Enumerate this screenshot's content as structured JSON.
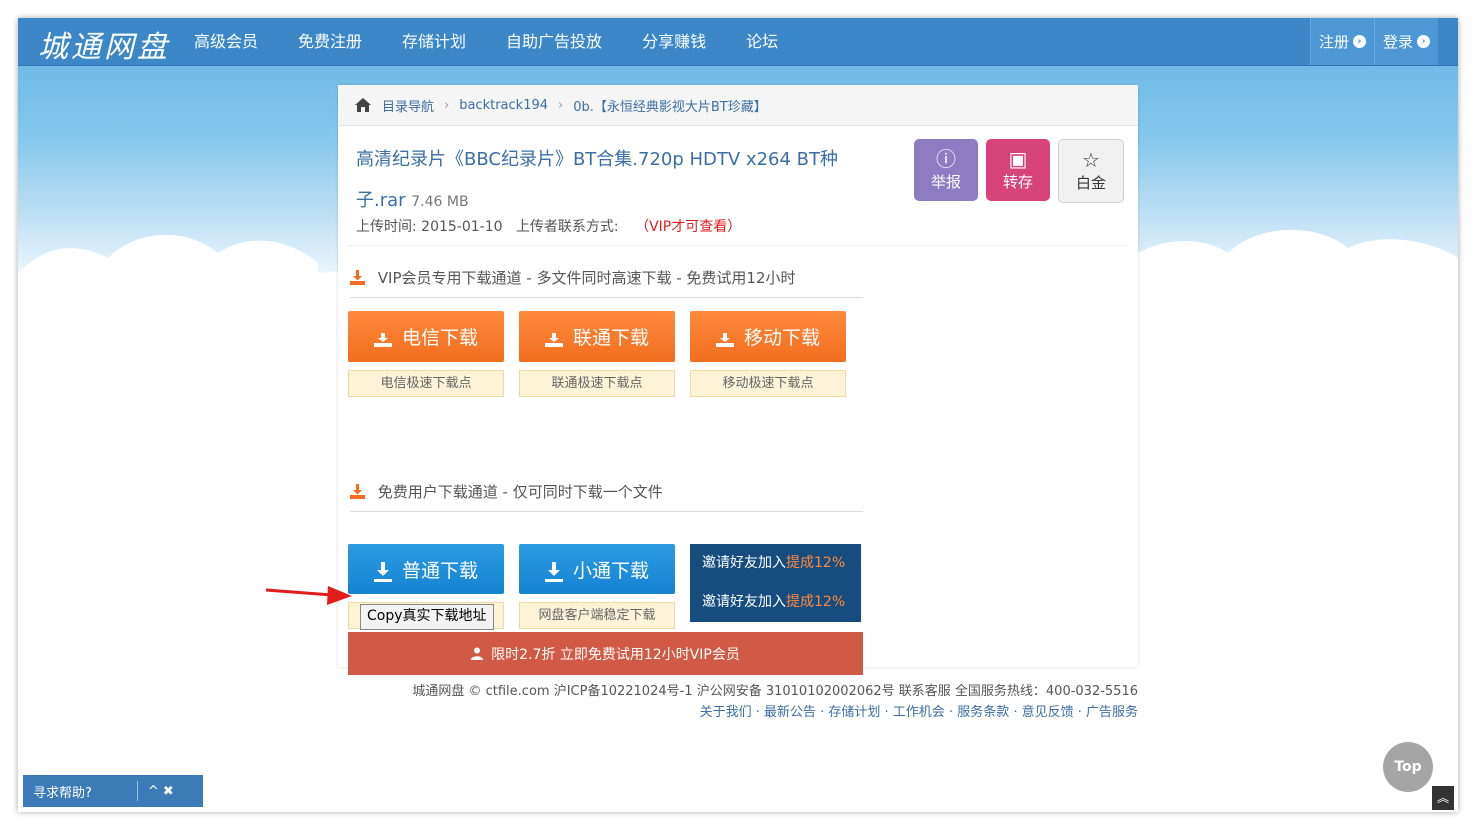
{
  "header": {
    "logo": "城通网盘",
    "nav": [
      "高级会员",
      "免费注册",
      "存储计划",
      "自助广告投放",
      "分享赚钱",
      "论坛"
    ],
    "register_label": "注册",
    "login_label": "登录"
  },
  "breadcrumb": {
    "items": [
      "目录导航",
      "backtrack194",
      "0b.【永恒经典影视大片BT珍藏】"
    ]
  },
  "file": {
    "name": "高清纪录片《BBC纪录片》BT合集.720p HDTV x264 BT种子.rar",
    "size": "7.46 MB",
    "upload_label": "上传时间:",
    "upload_date": "2015-01-10",
    "contact_label": "上传者联系方式:",
    "contact_value": "（VIP才可查看）"
  },
  "actions": {
    "report": "举报",
    "save": "转存",
    "platinum": "白金"
  },
  "vip_section": {
    "heading": "VIP会员专用下载通道 - 多文件同时高速下载 - 免费试用12小时",
    "buttons": [
      {
        "label": "电信下载",
        "tip": "电信极速下载点"
      },
      {
        "label": "联通下载",
        "tip": "联通极速下载点"
      },
      {
        "label": "移动下载",
        "tip": "移动极速下载点"
      }
    ]
  },
  "free_section": {
    "heading": "免费用户下载通道 - 仅可同时下载一个文件",
    "normal_label": "普通下载",
    "xiaotong_label": "小通下载",
    "xiaotong_tip": "网盘客户端稳定下载",
    "copy_label": "Copy真实下载地址",
    "invite_prefix": "邀请好友加入",
    "invite_highlight": "提成12%",
    "promo": "限时2.7折 立即免费试用12小时VIP会员"
  },
  "footer": {
    "line1": "城通网盘 © ctfile.com  沪ICP备10221024号-1   沪公网安备 31010102002062号  联系客服  全国服务热线：400-032-5516",
    "line2": "关于我们 · 最新公告 · 存储计划 · 工作机会 · 服务条款 · 意见反馈 · 广告服务"
  },
  "help": {
    "label": "寻求帮助?",
    "controls": "^ ✖"
  },
  "top_button": "Top",
  "colors": {
    "header_blue": "#3b87c8",
    "vip_orange": "#f26d1f",
    "free_blue": "#1583d0",
    "promo_red": "#d05a46",
    "invite_navy": "#164c7e"
  }
}
